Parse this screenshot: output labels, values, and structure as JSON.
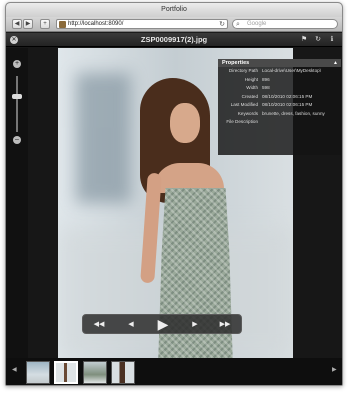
{
  "browser": {
    "window_title": "Portfolio",
    "address": "http://localhost:8090/",
    "search_placeholder": "Google"
  },
  "app": {
    "photo_title": "ZSP0009917(2).jpg",
    "properties": {
      "title": "Properties",
      "rows": [
        {
          "key": "Directory Path",
          "value": "Local-drive\\User\\MyDesktop\\"
        },
        {
          "key": "Height",
          "value": "896"
        },
        {
          "key": "Width",
          "value": "598"
        },
        {
          "key": "Created",
          "value": "08/10/2010 02:06:15 PM"
        },
        {
          "key": "Last Modified",
          "value": "08/10/2010 02:06:15 PM"
        },
        {
          "key": "Keywords",
          "value": "brunette, dress, fashion, sunny"
        },
        {
          "key": "File Description",
          "value": ""
        }
      ]
    },
    "controls": {
      "first": "◀◀",
      "previous": "◀",
      "play": "▶",
      "next": "▶",
      "last": "▶▶"
    },
    "filmstrip": {
      "left_arrow": "◀",
      "right_arrow": "▶",
      "thumbnails": [
        "thumb-1",
        "thumb-2",
        "thumb-3",
        "thumb-4"
      ],
      "selected_index": 1
    }
  }
}
